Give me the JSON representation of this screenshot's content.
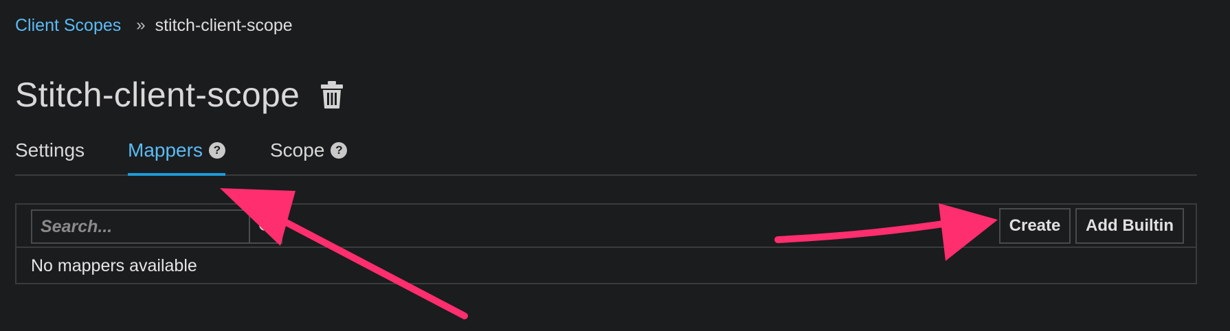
{
  "breadcrumb": {
    "parent": "Client Scopes",
    "separator": "»",
    "current": "stitch-client-scope"
  },
  "page": {
    "title": "Stitch-client-scope",
    "delete_icon": "trash-icon"
  },
  "tabs": [
    {
      "label": "Settings",
      "active": false,
      "help": false
    },
    {
      "label": "Mappers",
      "active": true,
      "help": true
    },
    {
      "label": "Scope",
      "active": false,
      "help": true
    }
  ],
  "help_glyph": "?",
  "toolbar": {
    "search_placeholder": "Search...",
    "search_icon": "search-icon",
    "create_label": "Create",
    "add_builtin_label": "Add Builtin"
  },
  "table": {
    "empty_message": "No mappers available"
  },
  "annotations": {
    "arrow_color": "#ff2e6e"
  },
  "colors": {
    "background": "#1b1c1e",
    "link": "#5bbcf5",
    "active_tab_underline": "#1d9bd8"
  }
}
